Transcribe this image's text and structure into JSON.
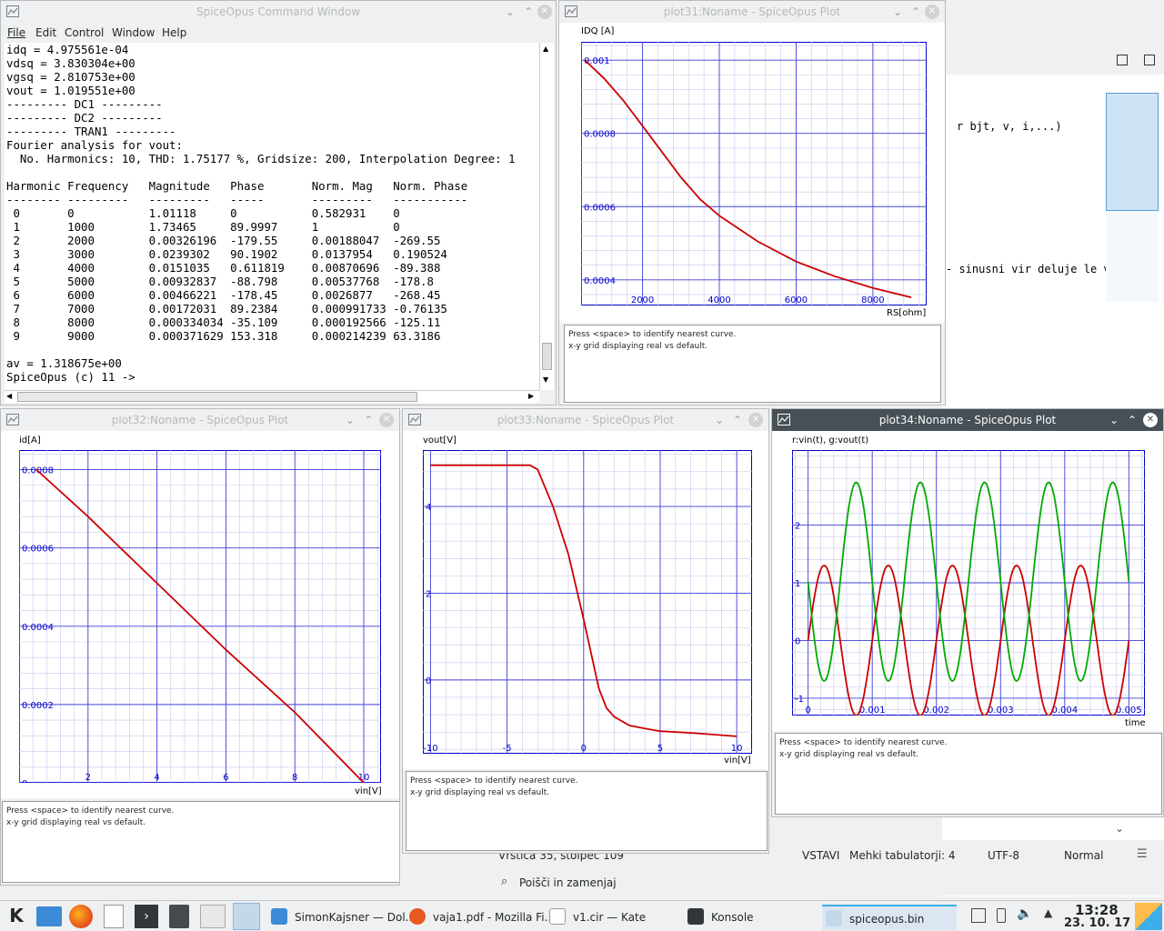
{
  "command_window": {
    "title": "SpiceOpus Command Window",
    "menu": [
      "File",
      "Edit",
      "Control",
      "Window",
      "Help"
    ],
    "lines": [
      "idq = 4.975561e-04",
      "vdsq = 3.830304e+00",
      "vgsq = 2.810753e+00",
      "vout = 1.019551e+00",
      "--------- DC1 ---------",
      "--------- DC2 ---------",
      "--------- TRAN1 ---------",
      "Fourier analysis for vout:",
      "  No. Harmonics: 10, THD: 1.75177 %, Gridsize: 200, Interpolation Degree: 1",
      "",
      "Harmonic Frequency   Magnitude   Phase       Norm. Mag   Norm. Phase",
      "-------- ---------   ---------   -----       ---------   -----------",
      " 0       0           1.01118     0           0.582931    0",
      " 1       1000        1.73465     89.9997     1           0",
      " 2       2000        0.00326196  -179.55     0.00188047  -269.55",
      " 3       3000        0.0239302   90.1902     0.0137954   0.190524",
      " 4       4000        0.0151035   0.611819    0.00870696  -89.388",
      " 5       5000        0.00932837  -88.798     0.00537768  -178.8",
      " 6       6000        0.00466221  -178.45     0.0026877   -268.45",
      " 7       7000        0.00172031  89.2384     0.000991733 -0.76135",
      " 8       8000        0.000334034 -35.109     0.000192566 -125.11",
      " 9       9000        0.000371629 153.318     0.000214239 63.3186",
      "",
      "av = 1.318675e+00",
      "SpiceOpus (c) 11 ->"
    ]
  },
  "status_text": {
    "line1": "Press <space> to identify nearest curve.",
    "line2": "x-y grid displaying real vs default."
  },
  "plot31": {
    "title": "plot31:Noname - SpiceOpus Plot",
    "ylabel": "IDQ [A]",
    "xlabel": "RS[ohm]",
    "yticks": [
      "0.001",
      "0.0008",
      "0.0006",
      "0.0004"
    ],
    "xticks": [
      "2000",
      "4000",
      "6000",
      "8000"
    ]
  },
  "plot32": {
    "title": "plot32:Noname - SpiceOpus Plot",
    "ylabel": "id[A]",
    "xlabel": "vin[V]",
    "yticks": [
      "0.0008",
      "0.0006",
      "0.0004",
      "0.0002",
      "0"
    ],
    "xticks": [
      "2",
      "4",
      "6",
      "8",
      "10"
    ]
  },
  "plot33": {
    "title": "plot33:Noname - SpiceOpus Plot",
    "ylabel": "vout[V]",
    "xlabel": "vin[V]",
    "yticks": [
      "4",
      "2",
      "0"
    ],
    "xticks": [
      "-10",
      "-5",
      "0",
      "5",
      "10"
    ]
  },
  "plot34": {
    "title": "plot34:Noname - SpiceOpus Plot",
    "ylabel": "r:vin(t), g:vout(t)",
    "xlabel": "time",
    "yticks": [
      "2",
      "1",
      "0",
      "-1"
    ],
    "xticks": [
      "0",
      "0.001",
      "0.002",
      "0.003",
      "0.004",
      "0.005"
    ]
  },
  "chart_data": [
    {
      "type": "line",
      "ylabel": "IDQ [A]",
      "xlabel": "RS[ohm]",
      "xlim": [
        400,
        9400
      ],
      "ylim": [
        0.00033,
        0.00105
      ],
      "grid": true,
      "series": [
        {
          "x": [
            500,
            1000,
            1500,
            2000,
            2500,
            3000,
            3500,
            4000,
            5000,
            6000,
            7000,
            8000,
            9000
          ],
          "values": [
            0.001,
            0.00095,
            0.00089,
            0.00082,
            0.00075,
            0.00068,
            0.00062,
            0.000575,
            0.000505,
            0.00045,
            0.00041,
            0.000378,
            0.000352
          ],
          "color": "#cc0000"
        }
      ]
    },
    {
      "type": "line",
      "ylabel": "id[A]",
      "xlabel": "vin[V]",
      "xlim": [
        0,
        10.5
      ],
      "ylim": [
        0,
        0.00085
      ],
      "grid": true,
      "series": [
        {
          "x": [
            0.5,
            2,
            4,
            6,
            8,
            10
          ],
          "values": [
            0.0008,
            0.00068,
            0.00051,
            0.00034,
            0.00018,
            0.0
          ],
          "color": "#cc0000"
        }
      ]
    },
    {
      "type": "line",
      "ylabel": "vout[V]",
      "xlabel": "vin[V]",
      "xlim": [
        -10.5,
        11
      ],
      "ylim": [
        -1.7,
        5.3
      ],
      "grid": true,
      "series": [
        {
          "x": [
            -10,
            -7,
            -5,
            -3.5,
            -3,
            -2,
            -1,
            0,
            0.5,
            1,
            1.5,
            2,
            3,
            4,
            5,
            7,
            10
          ],
          "values": [
            4.95,
            4.95,
            4.95,
            4.95,
            4.85,
            4.0,
            2.9,
            1.4,
            0.6,
            -0.2,
            -0.65,
            -0.85,
            -1.05,
            -1.12,
            -1.18,
            -1.22,
            -1.3
          ],
          "color": "#cc0000"
        }
      ]
    },
    {
      "type": "line",
      "ylabel": "r:vin(t), g:vout(t)",
      "xlabel": "time",
      "xlim": [
        -0.00025,
        0.00525
      ],
      "ylim": [
        -1.3,
        3.3
      ],
      "grid": true,
      "series": [
        {
          "name": "vin(t)",
          "color": "#cc0000",
          "amplitude": 1.3,
          "offset": 0,
          "frequency": 1000,
          "phase": 0,
          "tmax": 0.005
        },
        {
          "name": "vout(t)",
          "color": "#00aa00",
          "amplitude": 1.72,
          "offset": 1.02,
          "frequency": 1000,
          "phase": 180,
          "tmax": 0.005
        }
      ]
    }
  ],
  "kate": {
    "code_fragment1": "r bjt, v, i,...)",
    "code_fragment2": "- sinusni vir deluje le v",
    "status_pos": "Vrstica 35, stolpec 109",
    "mode": "VSTAVI",
    "tabs": "Mehki tabulatorji: 4",
    "encoding": "UTF-8",
    "type": "Normal",
    "find": "Poišči in zamenjaj"
  },
  "taskbar": {
    "tasks": [
      {
        "label": "SimonKajsner — Dol...",
        "icon": "folder-icon"
      },
      {
        "label": "vaja1.pdf - Mozilla Fi...",
        "icon": "firefox-icon"
      },
      {
        "label": "v1.cir  — Kate",
        "icon": "document-icon"
      },
      {
        "label": "Konsole",
        "icon": "terminal-icon"
      },
      {
        "label": "spiceopus.bin",
        "icon": "plot-icon"
      }
    ],
    "time": "13:28",
    "date": "23. 10. 17"
  }
}
